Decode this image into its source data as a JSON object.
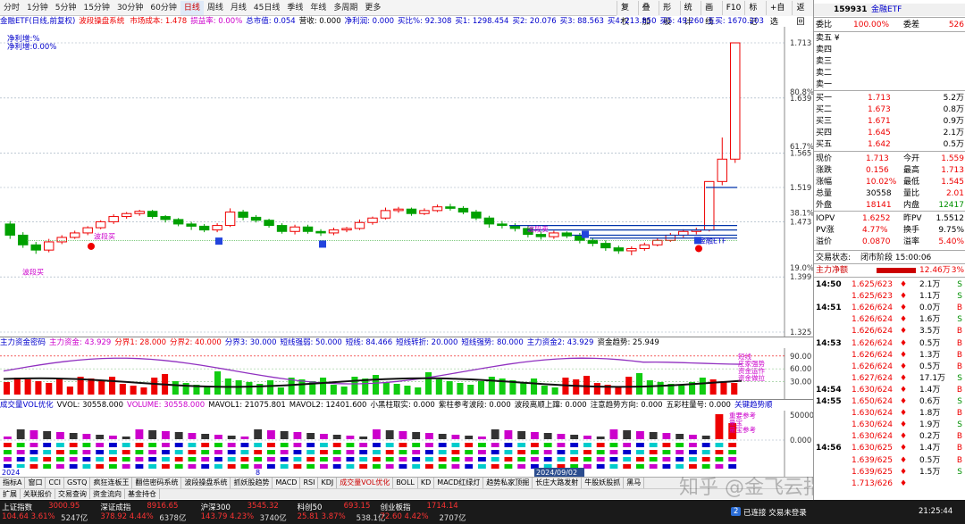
{
  "toolbar": {
    "periods": [
      "分时",
      "1分钟",
      "5分钟",
      "15分钟",
      "30分钟",
      "60分钟",
      "日线",
      "周线",
      "月线",
      "45日线",
      "季线",
      "年线",
      "多周期",
      "更多"
    ],
    "active_period": "日线",
    "right_buttons": [
      "复权",
      "叠加",
      "形股",
      "统计",
      "画线",
      "F10",
      "标记",
      "+自选",
      "返回"
    ]
  },
  "main_info": {
    "title": "金融ETF(日线,前复权)",
    "indicator": "波段操盘系统",
    "items": [
      {
        "k": "市场成本:",
        "v": "1.478",
        "c": "#e00"
      },
      {
        "k": "损益率:",
        "v": "0.00%",
        "c": "#c0c"
      },
      {
        "k": "总市值:",
        "v": "0.054",
        "c": "#00c"
      },
      {
        "k": "营收:",
        "v": "0.000",
        "c": "#000"
      },
      {
        "k": "净利润:",
        "v": "0.000",
        "c": "#00c"
      },
      {
        "k": "买比%:",
        "v": "92.308",
        "c": "#00c"
      },
      {
        "k": "买1:",
        "v": "1298.454",
        "c": "#00c"
      },
      {
        "k": "买2:",
        "v": "20.076",
        "c": "#00c"
      },
      {
        "k": "买3:",
        "v": "88.563",
        "c": "#00c"
      },
      {
        "k": "买4:",
        "v": "213.850",
        "c": "#00c"
      },
      {
        "k": "买5:",
        "v": "49.260",
        "c": "#00c"
      },
      {
        "k": "五买:",
        "v": "1670.203",
        "c": "#00c"
      }
    ],
    "side_notes": [
      "净利增:%",
      "净利增:0.00%"
    ],
    "signal_labels": [
      "波段买",
      "波段卖",
      "波段买",
      "金融ETF"
    ]
  },
  "price_axis": {
    "labels": [
      "1.713",
      "1.639",
      "1.565",
      "1.519",
      "1.473",
      "1.399",
      "1.325"
    ],
    "pcts": [
      "80.8%",
      "61.7%",
      "38.1%",
      "19.0%"
    ]
  },
  "chart_data": {
    "type": "candlestick",
    "candles": [
      [
        1.47,
        1.455,
        1.474,
        1.45
      ],
      [
        1.455,
        1.442,
        1.459,
        1.438
      ],
      [
        1.442,
        1.435,
        1.446,
        1.43
      ],
      [
        1.435,
        1.446,
        1.45,
        1.432
      ],
      [
        1.446,
        1.452,
        1.455,
        1.443
      ],
      [
        1.452,
        1.458,
        1.461,
        1.45
      ],
      [
        1.458,
        1.465,
        1.467,
        1.455
      ],
      [
        1.465,
        1.473,
        1.475,
        1.463
      ],
      [
        1.473,
        1.48,
        1.483,
        1.47
      ],
      [
        1.48,
        1.484,
        1.486,
        1.477
      ],
      [
        1.484,
        1.487,
        1.489,
        1.481
      ],
      [
        1.487,
        1.48,
        1.489,
        1.477
      ],
      [
        1.48,
        1.476,
        1.482,
        1.472
      ],
      [
        1.476,
        1.47,
        1.478,
        1.467
      ],
      [
        1.47,
        1.467,
        1.473,
        1.462
      ],
      [
        1.467,
        1.462,
        1.47,
        1.459
      ],
      [
        1.462,
        1.468,
        1.471,
        1.459
      ],
      [
        1.468,
        1.486,
        1.491,
        1.466
      ],
      [
        1.486,
        1.479,
        1.489,
        1.475
      ],
      [
        1.479,
        1.475,
        1.482,
        1.472
      ],
      [
        1.475,
        1.468,
        1.477,
        1.465
      ],
      [
        1.468,
        1.46,
        1.471,
        1.457
      ],
      [
        1.46,
        1.466,
        1.469,
        1.456
      ],
      [
        1.466,
        1.46,
        1.469,
        1.457
      ],
      [
        1.46,
        1.458,
        1.463,
        1.454
      ],
      [
        1.458,
        1.462,
        1.465,
        1.455
      ],
      [
        1.462,
        1.464,
        1.466,
        1.459
      ],
      [
        1.464,
        1.472,
        1.476,
        1.462
      ],
      [
        1.472,
        1.478,
        1.48,
        1.469
      ],
      [
        1.478,
        1.488,
        1.492,
        1.476
      ],
      [
        1.488,
        1.49,
        1.493,
        1.485
      ],
      [
        1.49,
        1.484,
        1.492,
        1.481
      ],
      [
        1.484,
        1.488,
        1.491,
        1.482
      ],
      [
        1.488,
        1.493,
        1.496,
        1.486
      ],
      [
        1.493,
        1.491,
        1.497,
        1.488
      ],
      [
        1.491,
        1.486,
        1.494,
        1.483
      ],
      [
        1.486,
        1.478,
        1.489,
        1.475
      ],
      [
        1.478,
        1.47,
        1.481,
        1.465
      ],
      [
        1.47,
        1.468,
        1.474,
        1.464
      ],
      [
        1.468,
        1.464,
        1.471,
        1.46
      ],
      [
        1.464,
        1.456,
        1.467,
        1.452
      ],
      [
        1.456,
        1.453,
        1.46,
        1.449
      ],
      [
        1.453,
        1.458,
        1.461,
        1.45
      ],
      [
        1.458,
        1.454,
        1.46,
        1.451
      ],
      [
        1.454,
        1.448,
        1.458,
        1.444
      ],
      [
        1.448,
        1.444,
        1.451,
        1.44
      ],
      [
        1.444,
        1.438,
        1.448,
        1.434
      ],
      [
        1.438,
        1.434,
        1.441,
        1.43
      ],
      [
        1.434,
        1.437,
        1.44,
        1.428
      ],
      [
        1.437,
        1.442,
        1.445,
        1.434
      ],
      [
        1.442,
        1.448,
        1.451,
        1.44
      ],
      [
        1.448,
        1.455,
        1.458,
        1.446
      ],
      [
        1.455,
        1.46,
        1.463,
        1.452
      ],
      [
        1.46,
        1.462,
        1.465,
        1.456
      ],
      [
        1.462,
        1.527,
        1.527,
        1.46
      ],
      [
        1.527,
        1.557,
        1.586,
        1.522
      ],
      [
        1.557,
        1.713,
        1.713,
        1.552
      ]
    ]
  },
  "indicator1": {
    "title": "主力资金密码",
    "items": [
      {
        "k": "主力资金:",
        "v": "43.929",
        "c": "#c0c"
      },
      {
        "k": "分界1:",
        "v": "28.000",
        "c": "#e00"
      },
      {
        "k": "分界2:",
        "v": "40.000",
        "c": "#e00"
      },
      {
        "k": "分界3:",
        "v": "30.000",
        "c": "#00c"
      },
      {
        "k": "短线强弱:",
        "v": "50.000",
        "c": "#00c"
      },
      {
        "k": "短线:",
        "v": "84.466",
        "c": "#00c"
      },
      {
        "k": "短线转折:",
        "v": "20.000",
        "c": "#00c"
      },
      {
        "k": "短线强势:",
        "v": "80.000",
        "c": "#00c"
      },
      {
        "k": "主力资金2:",
        "v": "43.929",
        "c": "#00c"
      },
      {
        "k": "资金趋势:",
        "v": "25.949",
        "c": "#000"
      }
    ],
    "axis": [
      "90.00",
      "60.00",
      "30.00"
    ],
    "notes": [
      "短线",
      "庄家强势",
      "资金运作",
      "资金做拉"
    ]
  },
  "indicator2": {
    "title": "成交量VOL优化",
    "items": [
      {
        "k": "VVOL:",
        "v": "30558.000",
        "c": "#000"
      },
      {
        "k": "VOLUME:",
        "v": "30558.000",
        "c": "#c0c"
      },
      {
        "k": "MAVOL1:",
        "v": "21075.801",
        "c": "#000"
      },
      {
        "k": "MAVOL2:",
        "v": "12401.600",
        "c": "#000"
      },
      {
        "k": "小黑柱取实:",
        "v": "0.000",
        "c": "#000"
      },
      {
        "k": "紫柱参考波段:",
        "v": "0.000",
        "c": "#000"
      },
      {
        "k": "波段离顺上蹿:",
        "v": "0.000",
        "c": "#000"
      },
      {
        "k": "注意趋势方向:",
        "v": "0.000",
        "c": "#000"
      },
      {
        "k": "五彩柱量号:",
        "v": "0.000",
        "c": "#000"
      },
      {
        "k": "关键趋势顺",
        "v": "",
        "c": "#00c"
      }
    ],
    "axis": [
      "50000",
      "0.000"
    ],
    "notes": [
      "重要参考",
      "量宝",
      "量宝参考"
    ]
  },
  "date_labels": [
    "2024",
    "8",
    "2024/09/02"
  ],
  "bottom_tabs": [
    "指标A",
    "窗口",
    "CCI",
    "GSTQ",
    "疯狂连板王",
    "翻倍密码系统",
    "波段操盘系统",
    "抓妖股趋势",
    "MACD",
    "RSI",
    "KDJ",
    "成交量VOL优化",
    "BOLL",
    "KD",
    "MACD红绿灯",
    "趋势私家顶掘",
    "长庄大路发射",
    "牛股妖股抓",
    "黑马"
  ],
  "bottom_tabs2": [
    "扩展",
    "关联报价",
    "交易查询",
    "资金流向",
    "基金持仓"
  ],
  "quote": {
    "code": "159931",
    "name": "金融ETF",
    "webi_label": "委比",
    "webi": "100.00%",
    "wecha_label": "委差",
    "wecha": "526",
    "sells": [
      {
        "k": "卖五",
        "p": "",
        "v": "",
        "flag": "¥"
      },
      {
        "k": "卖四",
        "p": "",
        "v": ""
      },
      {
        "k": "卖三",
        "p": "",
        "v": ""
      },
      {
        "k": "卖二",
        "p": "",
        "v": ""
      },
      {
        "k": "卖一",
        "p": "",
        "v": ""
      }
    ],
    "buys": [
      {
        "k": "买一",
        "p": "1.713",
        "v": "5.2万"
      },
      {
        "k": "买二",
        "p": "1.673",
        "v": "0.8万"
      },
      {
        "k": "买三",
        "p": "1.671",
        "v": "0.9万"
      },
      {
        "k": "买四",
        "p": "1.645",
        "v": "2.1万"
      },
      {
        "k": "买五",
        "p": "1.642",
        "v": "0.5万"
      }
    ],
    "stats": [
      {
        "k1": "现价",
        "v1": "1.713",
        "k2": "今开",
        "v2": "1.559",
        "c1": "#e00",
        "c2": "#e00"
      },
      {
        "k1": "涨跌",
        "v1": "0.156",
        "k2": "最高",
        "v2": "1.713",
        "c1": "#e00",
        "c2": "#e00"
      },
      {
        "k1": "涨幅",
        "v1": "10.02%",
        "k2": "最低",
        "v2": "1.545",
        "c1": "#e00",
        "c2": "#e00"
      },
      {
        "k1": "总量",
        "v1": "30558",
        "k2": "量比",
        "v2": "2.01",
        "c1": "#000",
        "c2": "#e00"
      },
      {
        "k1": "外盘",
        "v1": "18141",
        "k2": "内盘",
        "v2": "12417",
        "c1": "#e00",
        "c2": "#009000"
      }
    ],
    "stats2": [
      {
        "k1": "IOPV",
        "v1": "1.6252",
        "k2": "昨PV",
        "v2": "1.5512",
        "c1": "#e00",
        "c2": "#000"
      },
      {
        "k1": "PV涨",
        "v1": "4.77%",
        "k2": "换手",
        "v2": "9.75%",
        "c1": "#e00",
        "c2": "#000"
      },
      {
        "k1": "溢价",
        "v1": "0.0870",
        "k2": "溢率",
        "v2": "5.40%",
        "c1": "#e00",
        "c2": "#e00"
      }
    ],
    "trade_state_label": "交易状态:",
    "trade_state": "闭市阶段 15:00:06",
    "main_net_label": "主力净额",
    "main_net": "12.46万",
    "main_net_pct": "3%",
    "ticks": [
      {
        "t": "14:50",
        "p": "1.625/623",
        "v": "2.1万",
        "d": "S"
      },
      {
        "t": "",
        "p": "1.625/623",
        "v": "1.1万",
        "d": "S"
      },
      {
        "t": "14:51",
        "p": "1.626/624",
        "v": "0.0万",
        "d": "B"
      },
      {
        "t": "",
        "p": "1.626/624",
        "v": "1.6万",
        "d": "S"
      },
      {
        "t": "",
        "p": "1.626/624",
        "v": "3.5万",
        "d": "B"
      },
      {
        "t": "14:53",
        "p": "1.626/624",
        "v": "0.5万",
        "d": "B"
      },
      {
        "t": "",
        "p": "1.626/624",
        "v": "1.3万",
        "d": "B"
      },
      {
        "t": "",
        "p": "1.626/624",
        "v": "0.5万",
        "d": "B"
      },
      {
        "t": "",
        "p": "1.627/624",
        "v": "17.1万",
        "d": "S"
      },
      {
        "t": "14:54",
        "p": "1.630/624",
        "v": "1.4万",
        "d": "B"
      },
      {
        "t": "14:55",
        "p": "1.650/624",
        "v": "0.6万",
        "d": "S"
      },
      {
        "t": "",
        "p": "1.630/624",
        "v": "1.8万",
        "d": "B"
      },
      {
        "t": "",
        "p": "1.630/624",
        "v": "1.9万",
        "d": "S"
      },
      {
        "t": "",
        "p": "1.630/624",
        "v": "0.2万",
        "d": "B"
      },
      {
        "t": "14:56",
        "p": "1.630/625",
        "v": "1.4万",
        "d": "B"
      },
      {
        "t": "",
        "p": "1.639/625",
        "v": "0.5万",
        "d": "B"
      },
      {
        "t": "",
        "p": "1.639/625",
        "v": "1.5万",
        "d": "S"
      },
      {
        "t": "",
        "p": "1.713/626",
        "v": "",
        "d": ""
      }
    ]
  },
  "status_bar": {
    "indices": [
      {
        "name": "上证指数",
        "val": "3000.95",
        "chg": "104.64",
        "pct": "3.61%",
        "amt": "5247亿"
      },
      {
        "name": "深证成指",
        "val": "8916.65",
        "chg": "378.92",
        "pct": "4.44%",
        "amt": "6378亿"
      },
      {
        "name": "沪深300",
        "val": "3545.32",
        "chg": "143.79",
        "pct": "4.23%",
        "amt": "3740亿"
      },
      {
        "name": "科创50",
        "val": "693.15",
        "chg": "25.81",
        "pct": "3.87%",
        "amt": "538.1亿"
      },
      {
        "name": "创业板指",
        "val": "1714.14",
        "chg": "72.60",
        "pct": "4.42%",
        "amt": "2707亿"
      }
    ],
    "conn_badge": "2",
    "conn_text": "已连接 交易未登录",
    "time": "21:25:44",
    "watermark": "知乎 @金飞云指标"
  }
}
